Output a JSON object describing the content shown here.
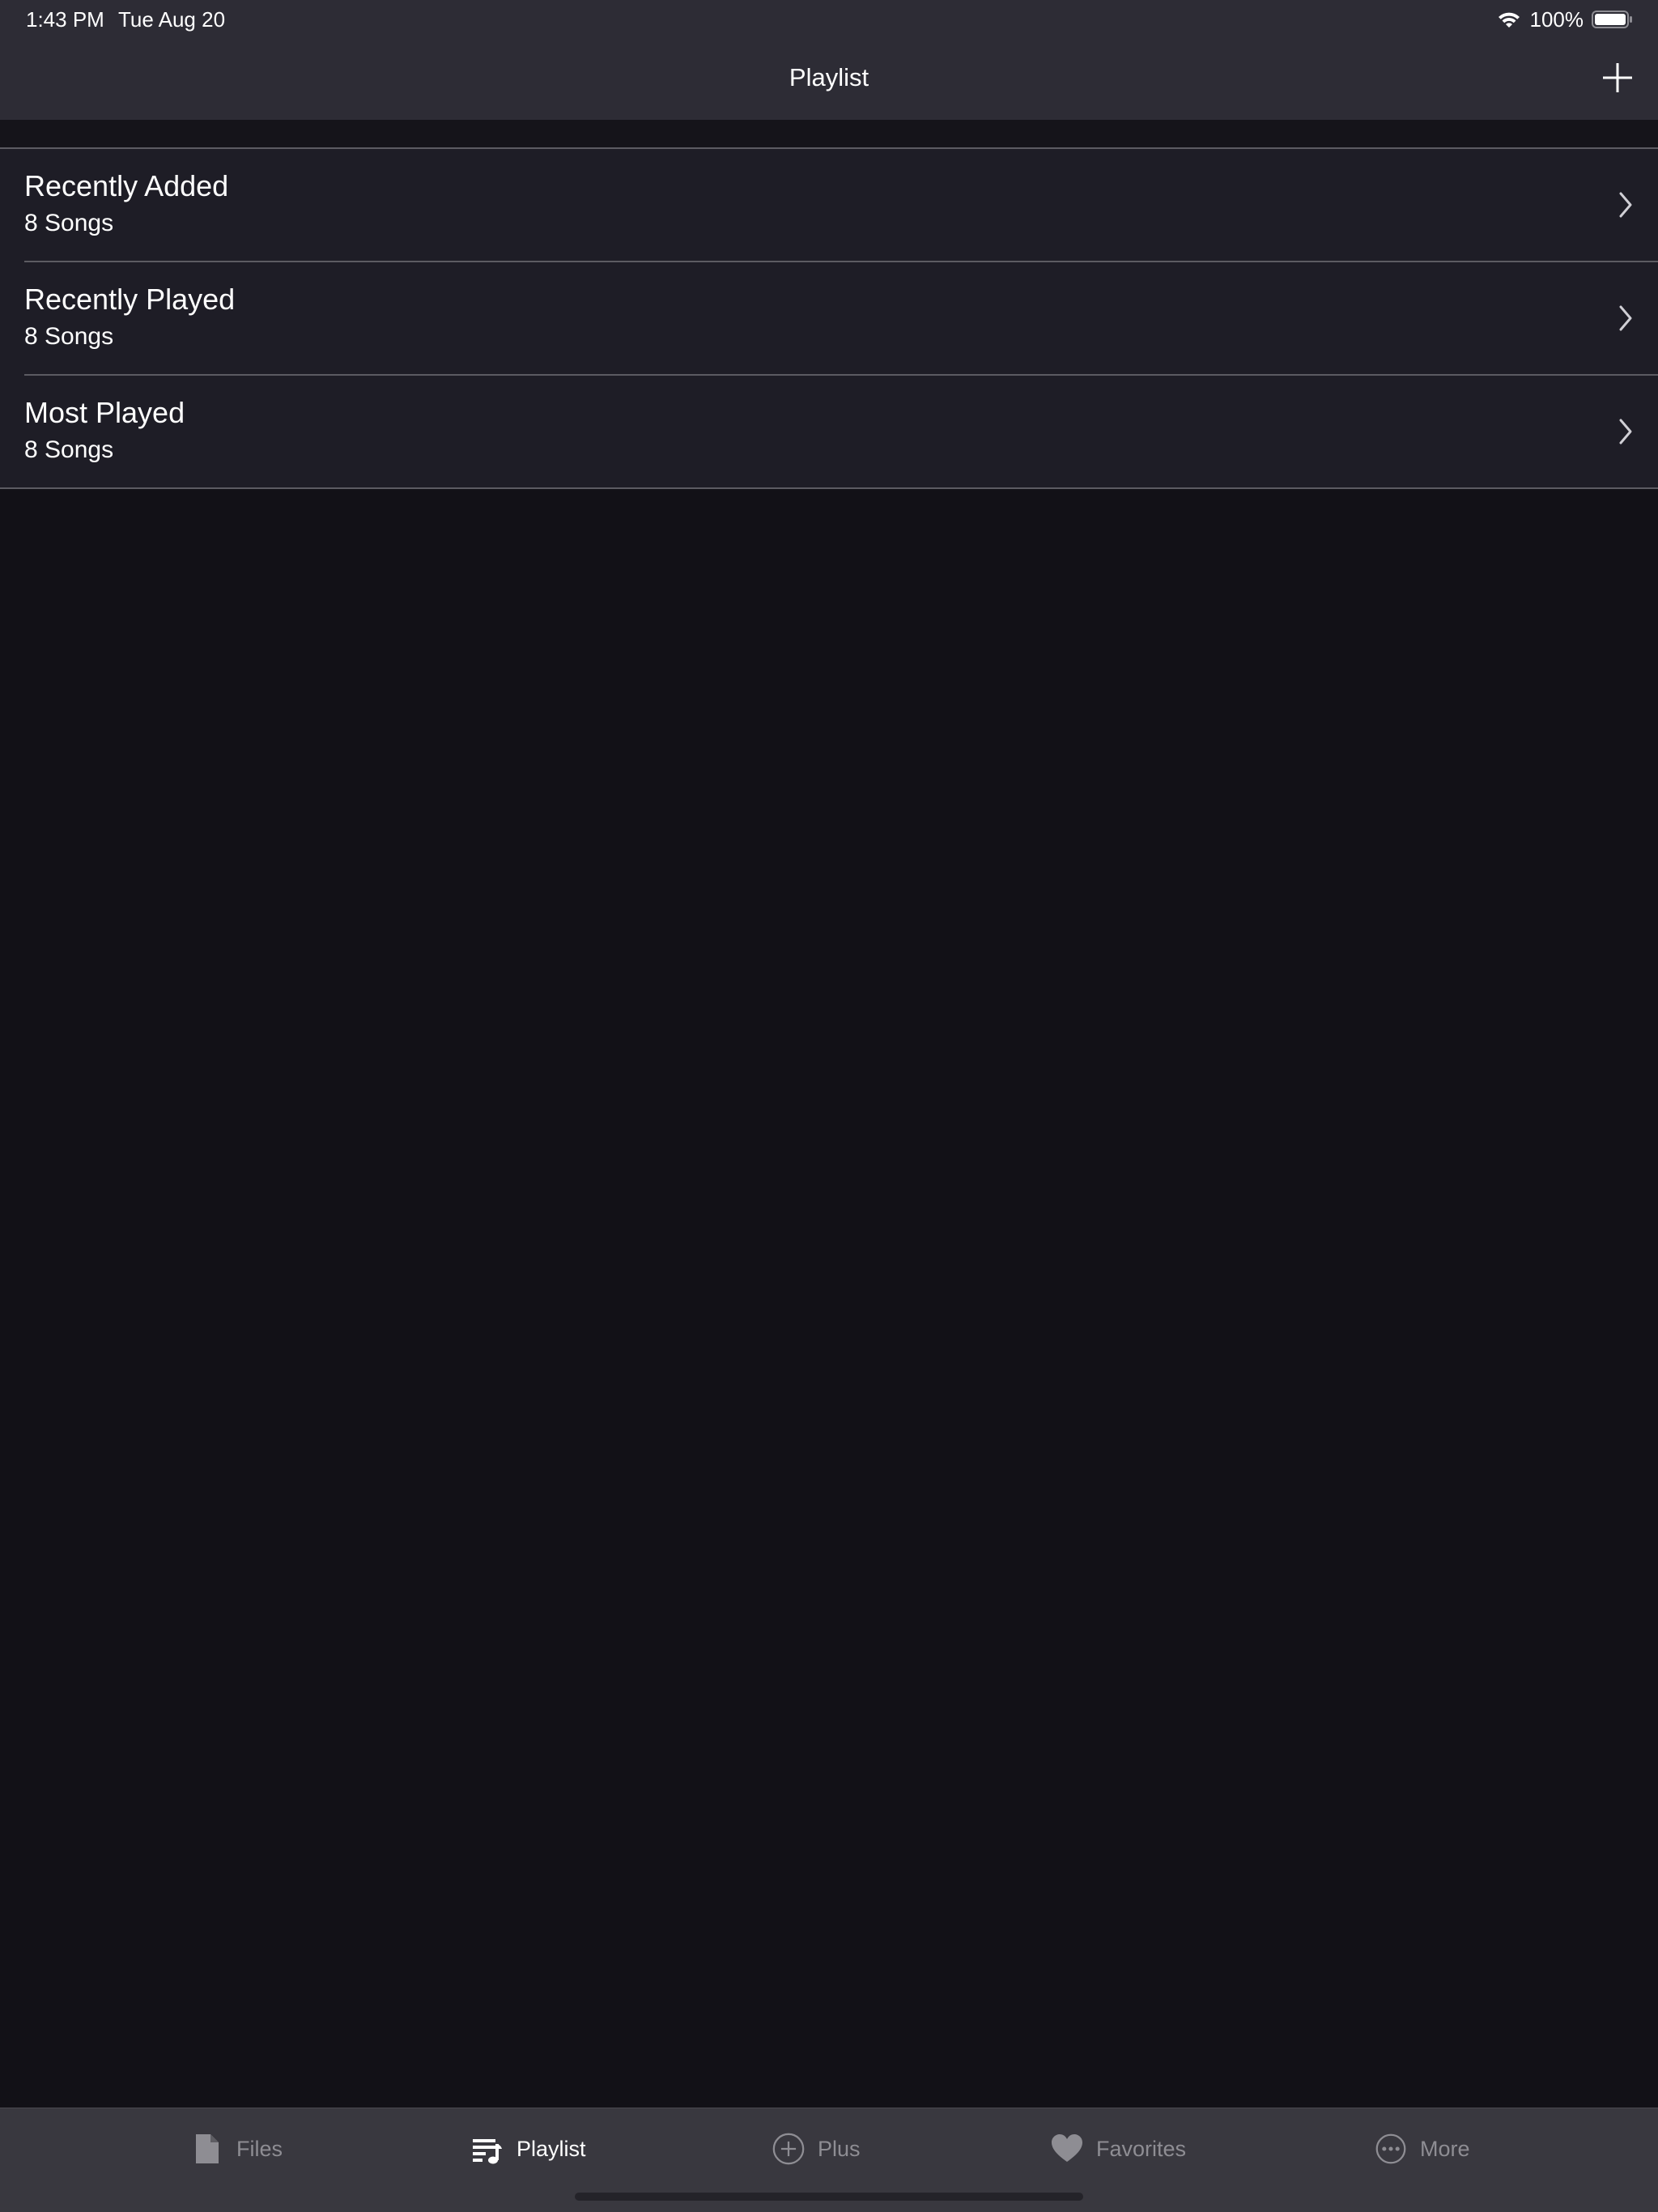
{
  "status_bar": {
    "time": "1:43 PM",
    "date": "Tue Aug 20",
    "battery_percent": "100%",
    "battery_level": 1.0,
    "icons": [
      "wifi-icon",
      "battery-icon"
    ]
  },
  "header": {
    "title": "Playlist",
    "add_icon": "plus-icon"
  },
  "playlists": [
    {
      "title": "Recently Added",
      "subtitle": "8 Songs"
    },
    {
      "title": "Recently Played",
      "subtitle": "8 Songs"
    },
    {
      "title": "Most Played",
      "subtitle": "8 Songs"
    }
  ],
  "tab_bar": {
    "tabs": [
      {
        "label": "Files",
        "icon": "file-icon",
        "active": false
      },
      {
        "label": "Playlist",
        "icon": "playlist-icon",
        "active": true
      },
      {
        "label": "Plus",
        "icon": "plus-circle-icon",
        "active": false
      },
      {
        "label": "Favorites",
        "icon": "heart-icon",
        "active": false
      },
      {
        "label": "More",
        "icon": "more-icon",
        "active": false
      }
    ]
  },
  "colors": {
    "background": "#121117",
    "header_background": "#2d2c35",
    "list_background": "#1e1d26",
    "tab_bar_background": "#39383f",
    "inactive_tab": "#8e8d93",
    "active_tab": "#ffffff"
  }
}
